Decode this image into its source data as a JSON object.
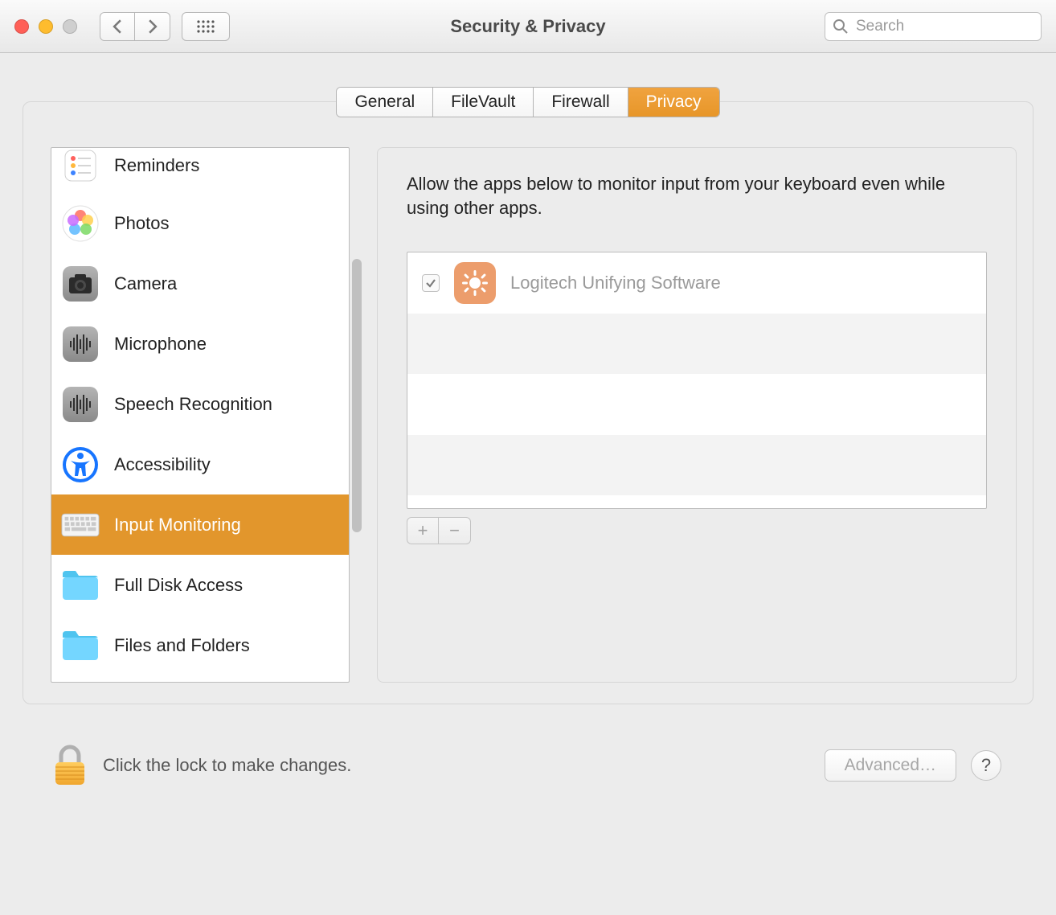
{
  "window": {
    "title": "Security & Privacy",
    "search_placeholder": "Search"
  },
  "tabs": [
    {
      "label": "General",
      "active": false
    },
    {
      "label": "FileVault",
      "active": false
    },
    {
      "label": "Firewall",
      "active": false
    },
    {
      "label": "Privacy",
      "active": true
    }
  ],
  "sidebar": {
    "items": [
      {
        "label": "Reminders",
        "icon": "reminders",
        "selected": false
      },
      {
        "label": "Photos",
        "icon": "photos",
        "selected": false
      },
      {
        "label": "Camera",
        "icon": "camera",
        "selected": false
      },
      {
        "label": "Microphone",
        "icon": "microphone",
        "selected": false
      },
      {
        "label": "Speech Recognition",
        "icon": "speech",
        "selected": false
      },
      {
        "label": "Accessibility",
        "icon": "accessibility",
        "selected": false
      },
      {
        "label": "Input Monitoring",
        "icon": "keyboard",
        "selected": true
      },
      {
        "label": "Full Disk Access",
        "icon": "folder",
        "selected": false
      },
      {
        "label": "Files and Folders",
        "icon": "folder",
        "selected": false
      }
    ]
  },
  "right": {
    "description": "Allow the apps below to monitor input from your keyboard even while using other apps.",
    "apps": [
      {
        "name": "Logitech Unifying Software",
        "checked": true,
        "icon_color": "#ec9d6c"
      }
    ]
  },
  "footer": {
    "lock_text": "Click the lock to make changes.",
    "advanced_label": "Advanced…",
    "help_label": "?"
  }
}
